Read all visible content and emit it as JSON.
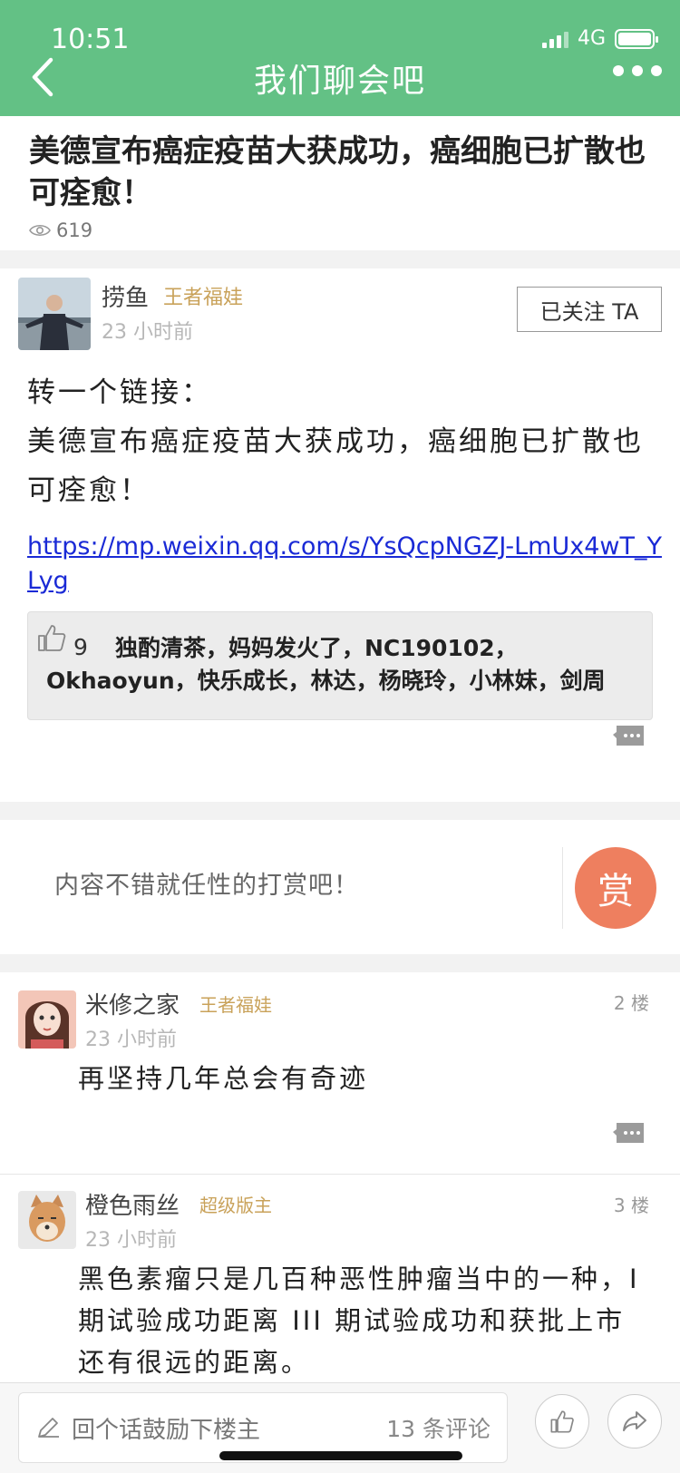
{
  "status_bar": {
    "time": "10:51",
    "network": "4G"
  },
  "nav": {
    "title": "我们聊会吧"
  },
  "article": {
    "title": "美德宣布癌症疫苗大获成功，癌细胞已扩散也可痊愈！",
    "views": "619"
  },
  "post": {
    "author": "捞鱼",
    "rank": "王者福娃",
    "time": "23 小时前",
    "follow_label": "已关注 TA",
    "body_line1": "转一个链接：",
    "body_line2": "美德宣布癌症疫苗大获成功，癌细胞已扩散也可痊愈！",
    "link": "https://mp.weixin.qq.com/s/YsQcpNGZJ-LmUx4wT_YLyg",
    "like_count": "9",
    "likers": "独酌清茶，妈妈发火了，NC190102，Okhaoyun，快乐成长，林达，杨晓玲，小林妹，剑周"
  },
  "reward": {
    "text": "内容不错就任性的打赏吧！",
    "button_label": "赏"
  },
  "comments": [
    {
      "author": "米修之家",
      "rank": "王者福娃",
      "time": "23 小时前",
      "floor": "2 楼",
      "text": "再坚持几年总会有奇迹"
    },
    {
      "author": "橙色雨丝",
      "rank": "超级版主",
      "time": "23 小时前",
      "floor": "3 楼",
      "text": "黑色素瘤只是几百种恶性肿瘤当中的一种，I 期试验成功距离 III 期试验成功和获批上市还有很远的距离。"
    }
  ],
  "bottom_bar": {
    "reply_placeholder": "回个话鼓励下楼主",
    "comment_count": "13 条评论"
  },
  "colors": {
    "header": "#63c185",
    "rank_gold": "#c9a25a",
    "link_blue": "#1a2ad6",
    "reward_orange": "#ee7f5f"
  }
}
